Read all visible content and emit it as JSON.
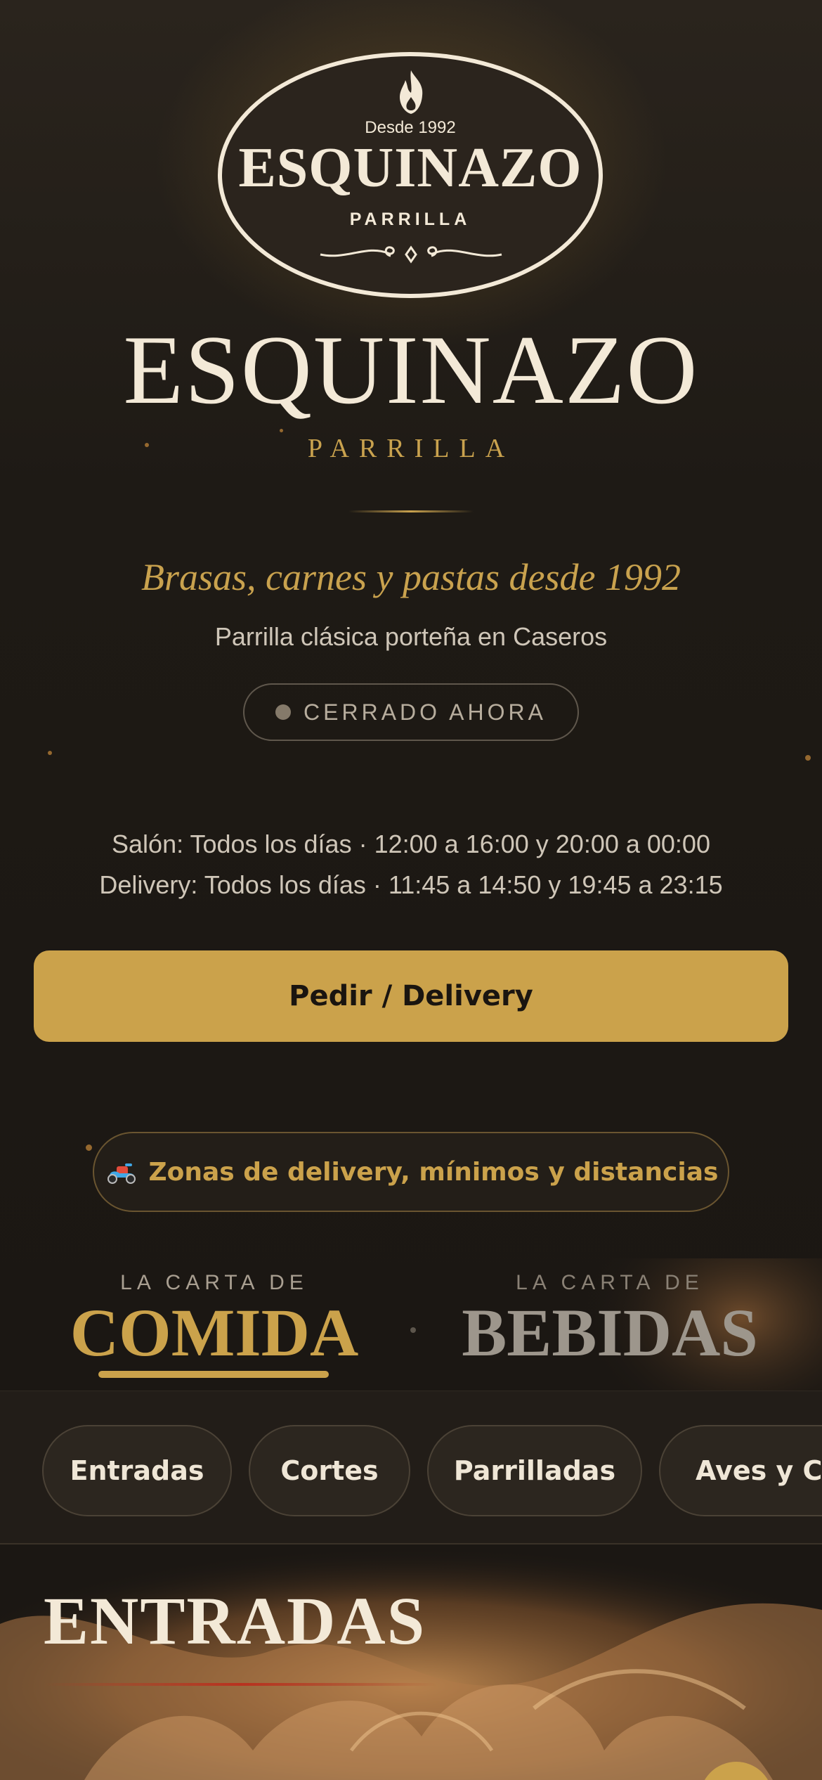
{
  "logo": {
    "since": "Desde 1992",
    "name": "ESQUINAZO",
    "sub": "PARRILLA"
  },
  "hero": {
    "title": "ESQUINAZO",
    "subtitle": "PARRILLA"
  },
  "tagline": "Brasas, carnes y pastas desde 1992",
  "location": "Parrilla clásica porteña en Caseros",
  "status": {
    "label": "CERRADO AHORA",
    "dot_color": "#857a6a"
  },
  "hours": {
    "salon": "Salón: Todos los días · 12:00 a 16:00 y 20:00 a 00:00",
    "delivery": "Delivery: Todos los días · 11:45 a 14:50 y 19:45 a 23:15"
  },
  "cta": {
    "label": "Pedir / Delivery",
    "color": "#cba24b"
  },
  "zones": {
    "icon": "scooter-icon",
    "label": "Zonas de delivery, mínimos y distancias"
  },
  "menu_tabs": [
    {
      "pre": "LA CARTA DE",
      "title": "COMIDA",
      "active": true
    },
    {
      "pre": "LA CARTA DE",
      "title": "BEBIDAS",
      "active": false
    }
  ],
  "categories": [
    "Entradas",
    "Cortes",
    "Parrilladas",
    "Aves y Ce"
  ],
  "section": {
    "title": "ENTRADAS"
  },
  "colors": {
    "accent": "#cba24b",
    "background": "#1b1713",
    "cream": "#f3e9d7"
  }
}
